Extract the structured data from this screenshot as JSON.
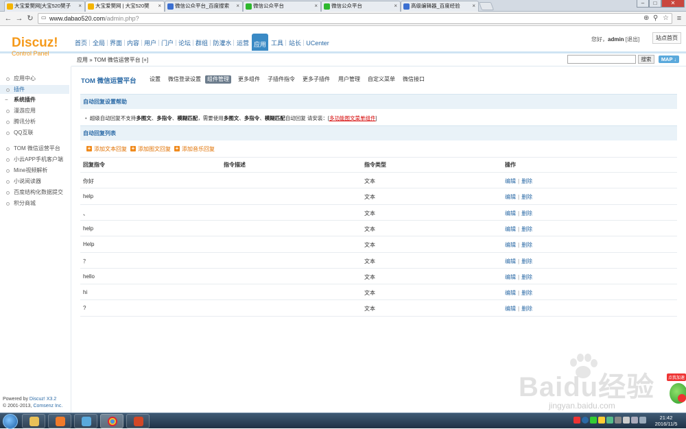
{
  "browser": {
    "tabs": [
      {
        "label": "大宝爱樊网[大宝520樊子",
        "active": false
      },
      {
        "label": "大宝爱樊网 | 大宝520樊",
        "active": true
      },
      {
        "label": "微信公众平台_百度搜索",
        "active": false
      },
      {
        "label": "微信公众平台",
        "active": false
      },
      {
        "label": "微信公众平台",
        "active": false
      },
      {
        "label": "高级编辑器_百度经验",
        "active": false
      }
    ],
    "url_host": "www.dabao520.com",
    "url_path": "/admin.php?"
  },
  "header": {
    "logo": "Discuz!",
    "logo_sub": "Control Panel",
    "nav": [
      "首页",
      "全局",
      "界面",
      "内容",
      "用户",
      "门户",
      "论坛",
      "群组",
      "防灌水",
      "运营",
      "应用",
      "工具",
      "站长",
      "UCenter"
    ],
    "active_nav": "应用",
    "greeting": "您好，",
    "username": "admin",
    "logout": "[退出]",
    "site_home": "站点首页"
  },
  "breadcrumb": {
    "text": "应用 » TOM 微信运营平台 [+]",
    "search_button": "搜索",
    "map_button": "MAP ↓"
  },
  "sidebar": {
    "items": [
      {
        "label": "应用中心",
        "type": "item"
      },
      {
        "label": "插件",
        "type": "item",
        "selected": true
      },
      {
        "label": "系统插件",
        "type": "head"
      },
      {
        "label": "漫游应用",
        "type": "item"
      },
      {
        "label": "腾讯分析",
        "type": "item"
      },
      {
        "label": "QQ互联",
        "type": "item"
      },
      {
        "label": "TOM 微信运营平台",
        "type": "item"
      },
      {
        "label": "小云APP手机客户端",
        "type": "item"
      },
      {
        "label": "Mine视频解析",
        "type": "item"
      },
      {
        "label": "小说阅读器",
        "type": "item"
      },
      {
        "label": "百度结构化数据提交",
        "type": "item"
      },
      {
        "label": "积分商城",
        "type": "item"
      }
    ],
    "powered_line1_a": "Powered by ",
    "powered_line1_b": "Discuz! X3.2",
    "powered_line2_a": "© 2001-2013, ",
    "powered_line2_b": "Comsenz Inc."
  },
  "main": {
    "title": "TOM 微信运营平台",
    "subnav": [
      "设置",
      "微信登录设置",
      "组件管理",
      "更多组件",
      "子插件指令",
      "更多子插件",
      "用户管理",
      "自定义菜单",
      "微信接口"
    ],
    "active_subnav": "组件管理",
    "help_title": "自动回复设置帮助",
    "help_text_pre": "超级自动回复不支持",
    "help_b1": "多图文",
    "help_sep1": "、",
    "help_b2": "多指令",
    "help_sep2": "、",
    "help_b3": "模糊匹配",
    "help_mid": "，需要使用",
    "help_b4": "多图文",
    "help_sep3": "、",
    "help_b5": "多指令",
    "help_sep4": "、",
    "help_b6": "模糊匹配",
    "help_tail": "自动回复 请安装：[",
    "help_link": "多功能图文菜单组件",
    "help_end": "]",
    "list_title": "自动回复列表",
    "add_links": [
      "添加文本回复",
      "添加图文回复",
      "添加音乐回复"
    ],
    "columns": [
      "回复指令",
      "指令描述",
      "指令类型",
      "操作"
    ],
    "rows": [
      {
        "cmd": "你好",
        "desc": "",
        "type": "文本"
      },
      {
        "cmd": "help",
        "desc": "",
        "type": "文本"
      },
      {
        "cmd": "、",
        "desc": "",
        "type": "文本"
      },
      {
        "cmd": "help",
        "desc": "",
        "type": "文本"
      },
      {
        "cmd": "Help",
        "desc": "",
        "type": "文本"
      },
      {
        "cmd": "？",
        "desc": "",
        "type": "文本"
      },
      {
        "cmd": "hello",
        "desc": "",
        "type": "文本"
      },
      {
        "cmd": "hi",
        "desc": "",
        "type": "文本"
      },
      {
        "cmd": "?",
        "desc": "",
        "type": "文本"
      }
    ],
    "edit_label": "编辑",
    "delete_label": "删除",
    "action_sep": "|"
  },
  "taskbar": {
    "time": "21:42",
    "date": "2016/11/5"
  },
  "watermark": {
    "brand": "Baidu经验",
    "url": "jingyan.baidu.com",
    "promo": "点我加速"
  }
}
